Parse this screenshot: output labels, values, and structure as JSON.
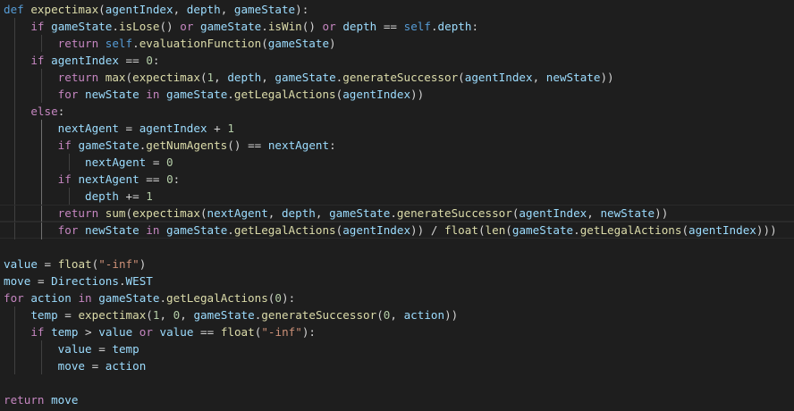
{
  "editor": {
    "theme": "dark",
    "background": "#1e1e1e",
    "lines": [
      "def expectimax(agentIndex, depth, gameState):",
      "    if gameState.isLose() or gameState.isWin() or depth == self.depth:",
      "        return self.evaluationFunction(gameState)",
      "    if agentIndex == 0:",
      "        return max(expectimax(1, depth, gameState.generateSuccessor(agentIndex, newState))",
      "        for newState in gameState.getLegalActions(agentIndex))",
      "    else:",
      "        nextAgent = agentIndex + 1",
      "        if gameState.getNumAgents() == nextAgent:",
      "            nextAgent = 0",
      "        if nextAgent == 0:",
      "            depth += 1",
      "        return sum(expectimax(nextAgent, depth, gameState.generateSuccessor(agentIndex, newState))",
      "        for newState in gameState.getLegalActions(agentIndex)) / float(len(gameState.getLegalActions(agentIndex)))",
      "",
      "value = float(\"-inf\")",
      "move = Directions.WEST",
      "for action in gameState.getLegalActions(0):",
      "    temp = expectimax(1, 0, gameState.generateSuccessor(0, action))",
      "    if temp > value or value == float(\"-inf\"):",
      "        value = temp",
      "        move = action",
      "",
      "return move"
    ]
  }
}
